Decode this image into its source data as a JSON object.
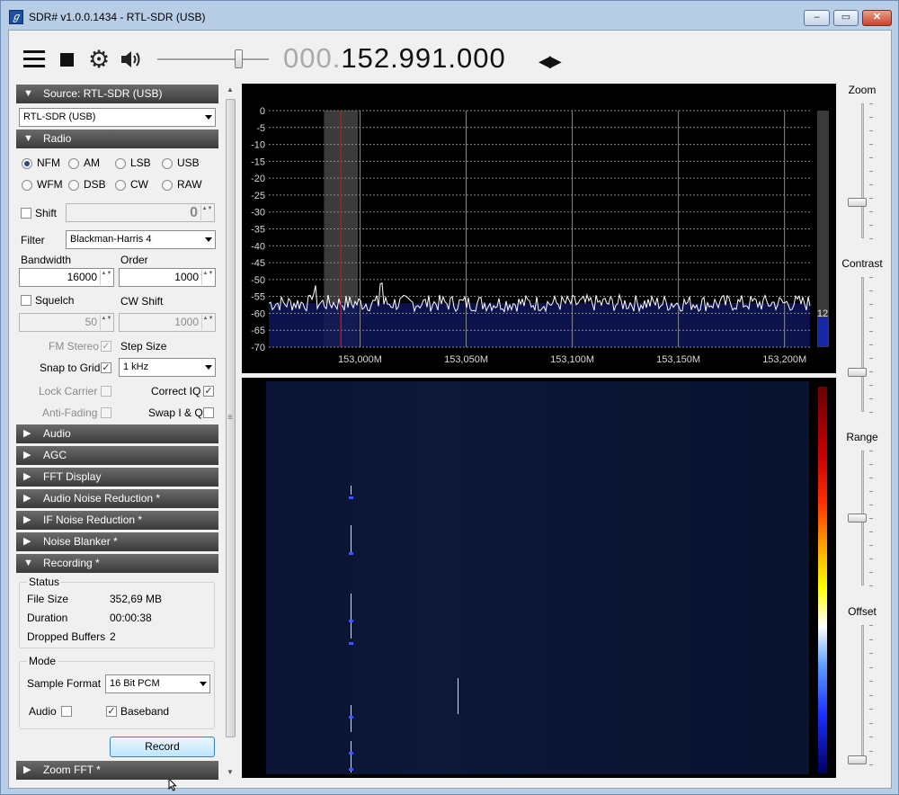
{
  "window": {
    "title": "SDR# v1.0.0.1434 - RTL-SDR (USB)",
    "controls": {
      "minimize": "–",
      "maximize": "▭",
      "close": "✕"
    }
  },
  "toolbar": {
    "frequency_dim": "000.",
    "frequency_main": "152.991.000",
    "tuner_arrows": "◀▶",
    "volume": 0.75
  },
  "panels": {
    "source": {
      "header": "Source: RTL-SDR (USB)",
      "expanded": true,
      "device": "RTL-SDR (USB)"
    },
    "radio": {
      "header": "Radio",
      "expanded": true,
      "modes": [
        {
          "label": "NFM",
          "checked": true
        },
        {
          "label": "AM",
          "checked": false
        },
        {
          "label": "LSB",
          "checked": false
        },
        {
          "label": "USB",
          "checked": false
        },
        {
          "label": "WFM",
          "checked": false
        },
        {
          "label": "DSB",
          "checked": false
        },
        {
          "label": "CW",
          "checked": false
        },
        {
          "label": "RAW",
          "checked": false
        }
      ],
      "shift_label": "Shift",
      "shift_value": "0",
      "filter_label": "Filter",
      "filter_value": "Blackman-Harris 4",
      "bandwidth_label": "Bandwidth",
      "bandwidth_value": "16000",
      "order_label": "Order",
      "order_value": "1000",
      "squelch_label": "Squelch",
      "squelch_value": "50",
      "cw_shift_label": "CW Shift",
      "cw_shift_value": "1000",
      "fm_stereo_label": "FM Stereo",
      "step_size_label": "Step Size",
      "snap_to_grid_label": "Snap to Grid",
      "step_size_value": "1 kHz",
      "lock_carrier_label": "Lock Carrier",
      "correct_iq_label": "Correct IQ",
      "anti_fading_label": "Anti-Fading",
      "swap_iq_label": "Swap I & Q"
    },
    "collapsed": [
      {
        "header": "Audio"
      },
      {
        "header": "AGC"
      },
      {
        "header": "FFT Display"
      },
      {
        "header": "Audio Noise Reduction *"
      },
      {
        "header": "IF Noise Reduction *"
      },
      {
        "header": "Noise Blanker *"
      }
    ],
    "recording": {
      "header": "Recording *",
      "status_title": "Status",
      "file_size_label": "File Size",
      "file_size_value": "352,69 MB",
      "duration_label": "Duration",
      "duration_value": "00:00:38",
      "dropped_label": "Dropped Buffers",
      "dropped_value": "2",
      "mode_title": "Mode",
      "sample_format_label": "Sample Format",
      "sample_format_value": "16 Bit PCM",
      "audio_label": "Audio",
      "baseband_label": "Baseband",
      "record_button": "Record"
    },
    "zoom_fft": {
      "header": "Zoom FFT *"
    }
  },
  "icons": {
    "collapse_arrow": "▼",
    "expand_arrow": "▶",
    "check": "✓",
    "gear": "⚙",
    "spin": "▲▼"
  },
  "chart_data": {
    "type": "line",
    "y_ticks": [
      "0",
      "-5",
      "-10",
      "-15",
      "-20",
      "-25",
      "-30",
      "-35",
      "-40",
      "-45",
      "-50",
      "-55",
      "-60",
      "-65",
      "-70"
    ],
    "ylim": [
      -70,
      0
    ],
    "x_ticks": [
      "153,000M",
      "153,050M",
      "153,100M",
      "153,150M",
      "153,200M"
    ],
    "x_tick_values": [
      153000000,
      153050000,
      153100000,
      153150000,
      153200000
    ],
    "xlim": [
      152957000,
      153212000
    ],
    "noise_floor_db": -57,
    "tuned_frequency": 152991000,
    "filter_band": [
      152983000,
      152999000
    ],
    "level_meter_value": "12",
    "grid": true
  },
  "sliders": {
    "zoom": {
      "label": "Zoom",
      "level": 0.25
    },
    "contrast": {
      "label": "Contrast",
      "level": 0.28
    },
    "range": {
      "label": "Range",
      "level": 0.5
    },
    "offset": {
      "label": "Offset",
      "level": 0.0
    }
  }
}
